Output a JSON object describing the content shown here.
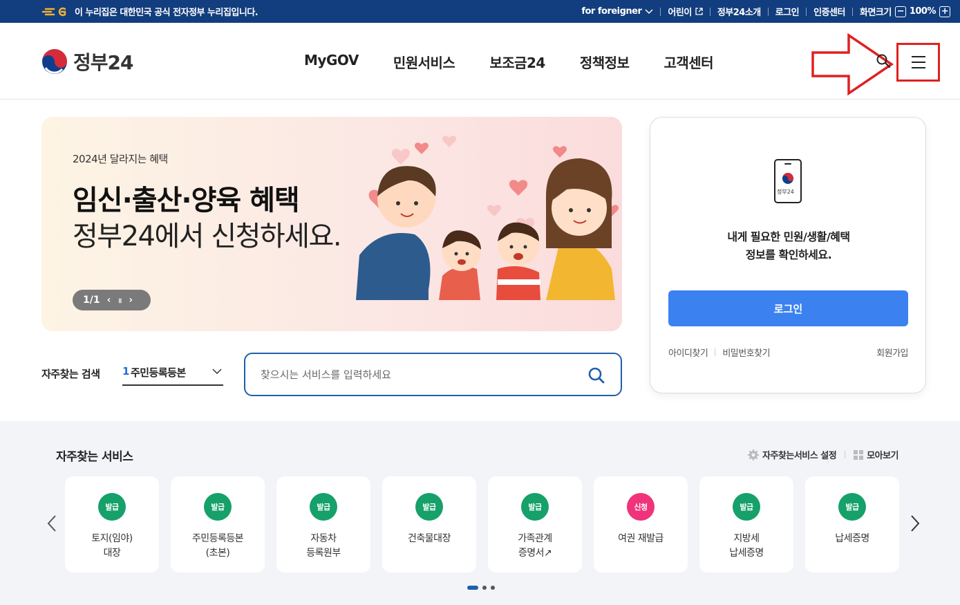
{
  "topbar": {
    "notice": "이 누리집은 대한민국 공식 전자정부 누리집입니다.",
    "links": {
      "foreigner": "for foreigner",
      "kids": "어린이",
      "about": "정부24소개",
      "login": "로그인",
      "cert": "인증센터",
      "screen_size": "화면크기",
      "zoom_minus": "−",
      "zoom_level": "100%",
      "zoom_plus": "+"
    }
  },
  "header": {
    "logo_text": "정부24",
    "gnb": [
      "MyGOV",
      "민원서비스",
      "보조금24",
      "정책정보",
      "고객센터"
    ]
  },
  "banner": {
    "subtitle": "2024년 달라지는 혜택",
    "title": "임신·출산·양육 혜택",
    "title2": "정부24에서 신청하세요.",
    "pager": "1/1",
    "prev": "‹",
    "pause": "॥",
    "next": "›"
  },
  "login_card": {
    "phone_label": "정부24",
    "message_line1": "내게 필요한 민원/생활/혜택",
    "message_line2": "정보를 확인하세요.",
    "login_button": "로그인",
    "find_id": "아이디찾기",
    "find_pw": "비밀번호찾기",
    "join": "회원가입"
  },
  "search": {
    "freq_label": "자주찾는 검색",
    "freq_selected_num": "1",
    "freq_selected": "주민등록등본",
    "placeholder": "찾으시는 서비스를 입력하세요"
  },
  "services": {
    "title": "자주찾는 서비스",
    "settings": "자주찾는서비스 설정",
    "view_all": "모아보기",
    "cards": [
      {
        "badge": "발급",
        "name": "토지(임야)\n대장",
        "color": "#16a06a"
      },
      {
        "badge": "발급",
        "name": "주민등록등본\n(초본)",
        "color": "#16a06a"
      },
      {
        "badge": "발급",
        "name": "자동차\n등록원부",
        "color": "#16a06a"
      },
      {
        "badge": "발급",
        "name": "건축물대장",
        "color": "#16a06a"
      },
      {
        "badge": "발급",
        "name": "가족관계\n증명서↗",
        "color": "#16a06a"
      },
      {
        "badge": "신청",
        "name": "여권 재발급",
        "color": "#f0337a"
      },
      {
        "badge": "발급",
        "name": "지방세\n납세증명",
        "color": "#16a06a"
      },
      {
        "badge": "발급",
        "name": "납세증명",
        "color": "#16a06a"
      }
    ]
  },
  "colors": {
    "topbar": "#123d7e",
    "primary_button": "#3b82f0",
    "annotation": "#e02020"
  }
}
